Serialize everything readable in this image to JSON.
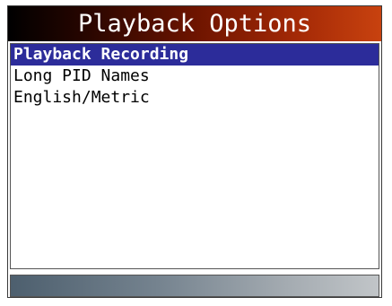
{
  "header": {
    "title": "Playback Options"
  },
  "menu": {
    "items": [
      {
        "label": "Playback Recording",
        "selected": true
      },
      {
        "label": "Long PID Names",
        "selected": false
      },
      {
        "label": "English/Metric",
        "selected": false
      }
    ]
  },
  "colors": {
    "selection_background": "#2c2c9a",
    "title_gradient_end": "#c8420f"
  }
}
